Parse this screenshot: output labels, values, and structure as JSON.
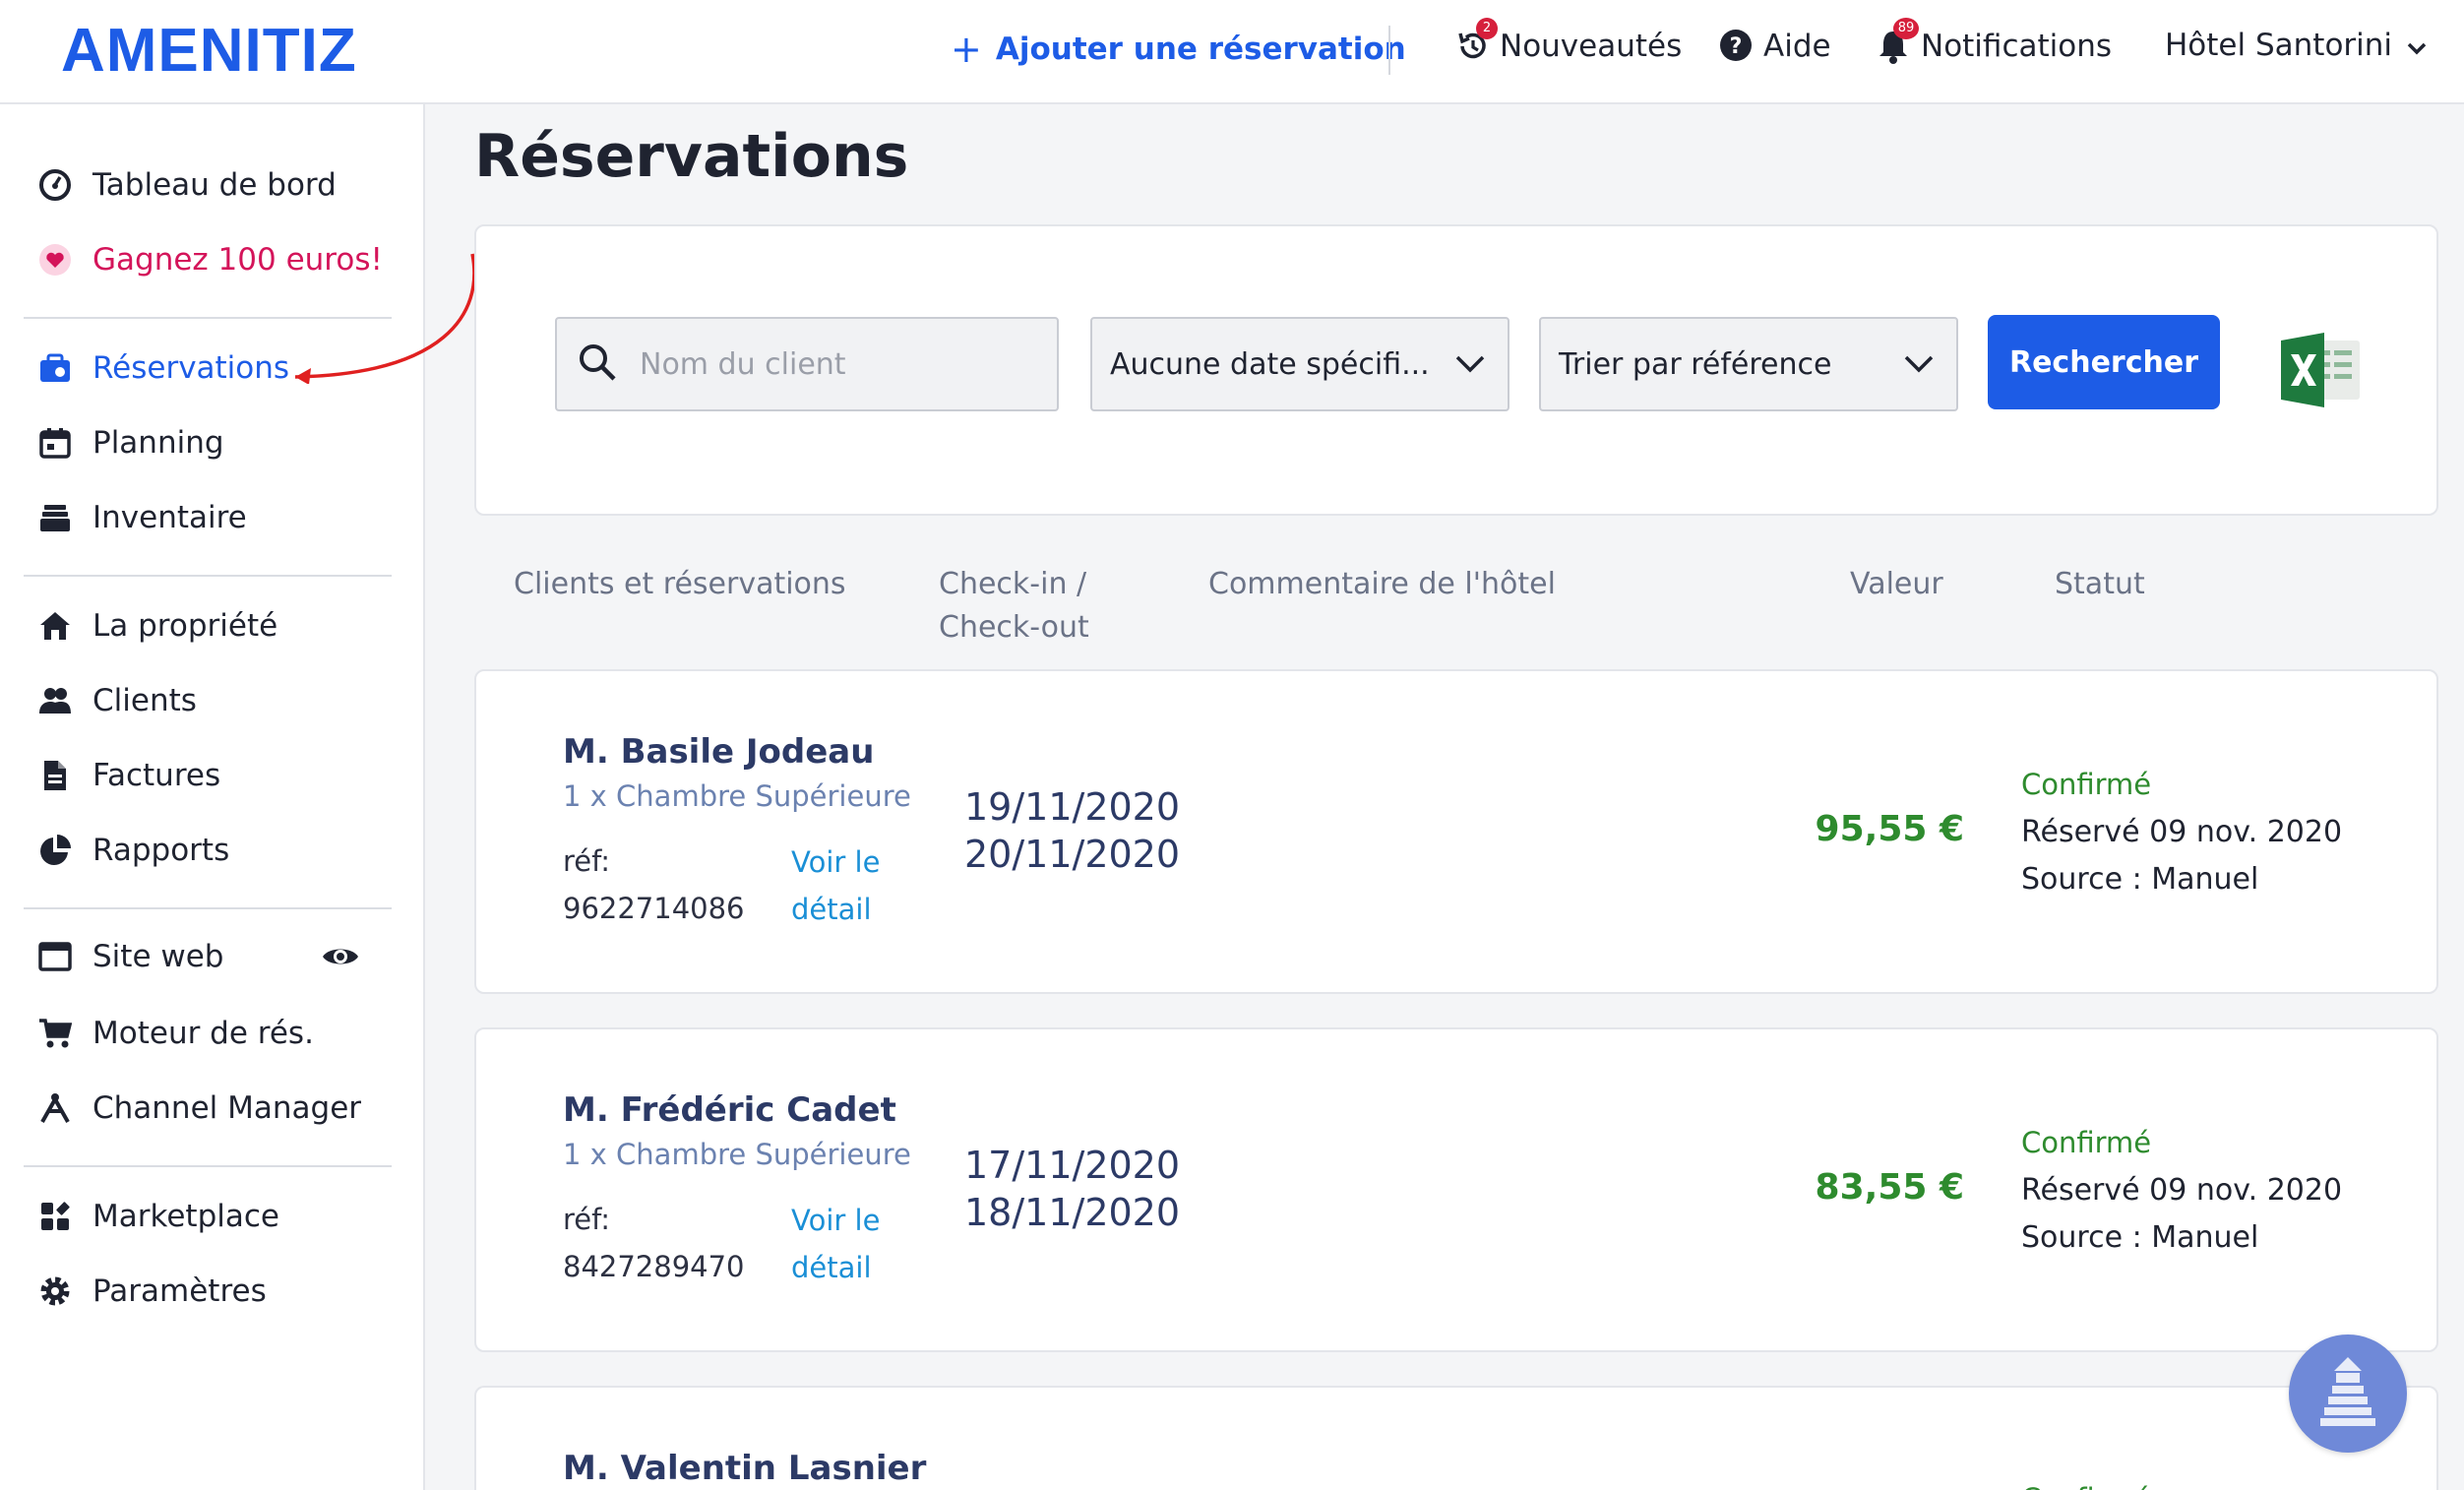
{
  "header": {
    "logo": "AMENITIZ",
    "add_reservation": "Ajouter une réservation",
    "news": "Nouveautés",
    "news_badge": "2",
    "help": "Aide",
    "notifications": "Notifications",
    "notifications_badge": "89",
    "hotel": "Hôtel Santorini"
  },
  "sidebar": {
    "items": [
      {
        "label": "Tableau de bord",
        "icon": "dashboard-icon"
      },
      {
        "label": "Gagnez 100 euros!",
        "icon": "heart-icon"
      },
      {
        "label": "Réservations",
        "icon": "reservations-icon"
      },
      {
        "label": "Planning",
        "icon": "calendar-icon"
      },
      {
        "label": "Inventaire",
        "icon": "inventory-icon"
      },
      {
        "label": "La propriété",
        "icon": "home-icon"
      },
      {
        "label": "Clients",
        "icon": "clients-icon"
      },
      {
        "label": "Factures",
        "icon": "invoice-icon"
      },
      {
        "label": "Rapports",
        "icon": "pie-chart-icon"
      },
      {
        "label": "Site web",
        "icon": "browser-window-icon"
      },
      {
        "label": "Moteur de rés.",
        "icon": "cart-icon"
      },
      {
        "label": "Channel Manager",
        "icon": "channel-icon"
      },
      {
        "label": "Marketplace",
        "icon": "marketplace-icon"
      },
      {
        "label": "Paramètres",
        "icon": "gear-icon"
      }
    ]
  },
  "main": {
    "title": "Réservations",
    "filters": {
      "search_placeholder": "Nom du client",
      "date_select": "Aucune date spécifi...",
      "sort_select": "Trier par référence",
      "search_button": "Rechercher"
    },
    "columns": {
      "clients": "Clients et réservations",
      "checkin_line1": "Check-in /",
      "checkin_line2": "Check-out",
      "comment": "Commentaire de l'hôtel",
      "value": "Valeur",
      "status": "Statut"
    },
    "reservations": [
      {
        "name": "M. Basile Jodeau",
        "room": "1 x Chambre Supérieure",
        "ref_label": "réf:",
        "ref": "9622714086",
        "detail_line1": "Voir le",
        "detail_line2": "détail",
        "checkin": "19/11/2020",
        "checkout": "20/11/2020",
        "value": "95,55 €",
        "status": "Confirmé",
        "booked": "Réservé 09 nov. 2020",
        "source": "Source : Manuel"
      },
      {
        "name": "M. Frédéric Cadet",
        "room": "1 x Chambre Supérieure",
        "ref_label": "réf:",
        "ref": "8427289470",
        "detail_line1": "Voir le",
        "detail_line2": "détail",
        "checkin": "17/11/2020",
        "checkout": "18/11/2020",
        "value": "83,55 €",
        "status": "Confirmé",
        "booked": "Réservé 09 nov. 2020",
        "source": "Source : Manuel"
      },
      {
        "name": "M. Valentin Lasnier",
        "status": "Confirmé"
      }
    ]
  },
  "colors": {
    "brand_blue": "#1d5ce6",
    "promo_pink": "#d4145a",
    "value_green": "#2e8b2e",
    "annotation_red": "#e02020"
  }
}
